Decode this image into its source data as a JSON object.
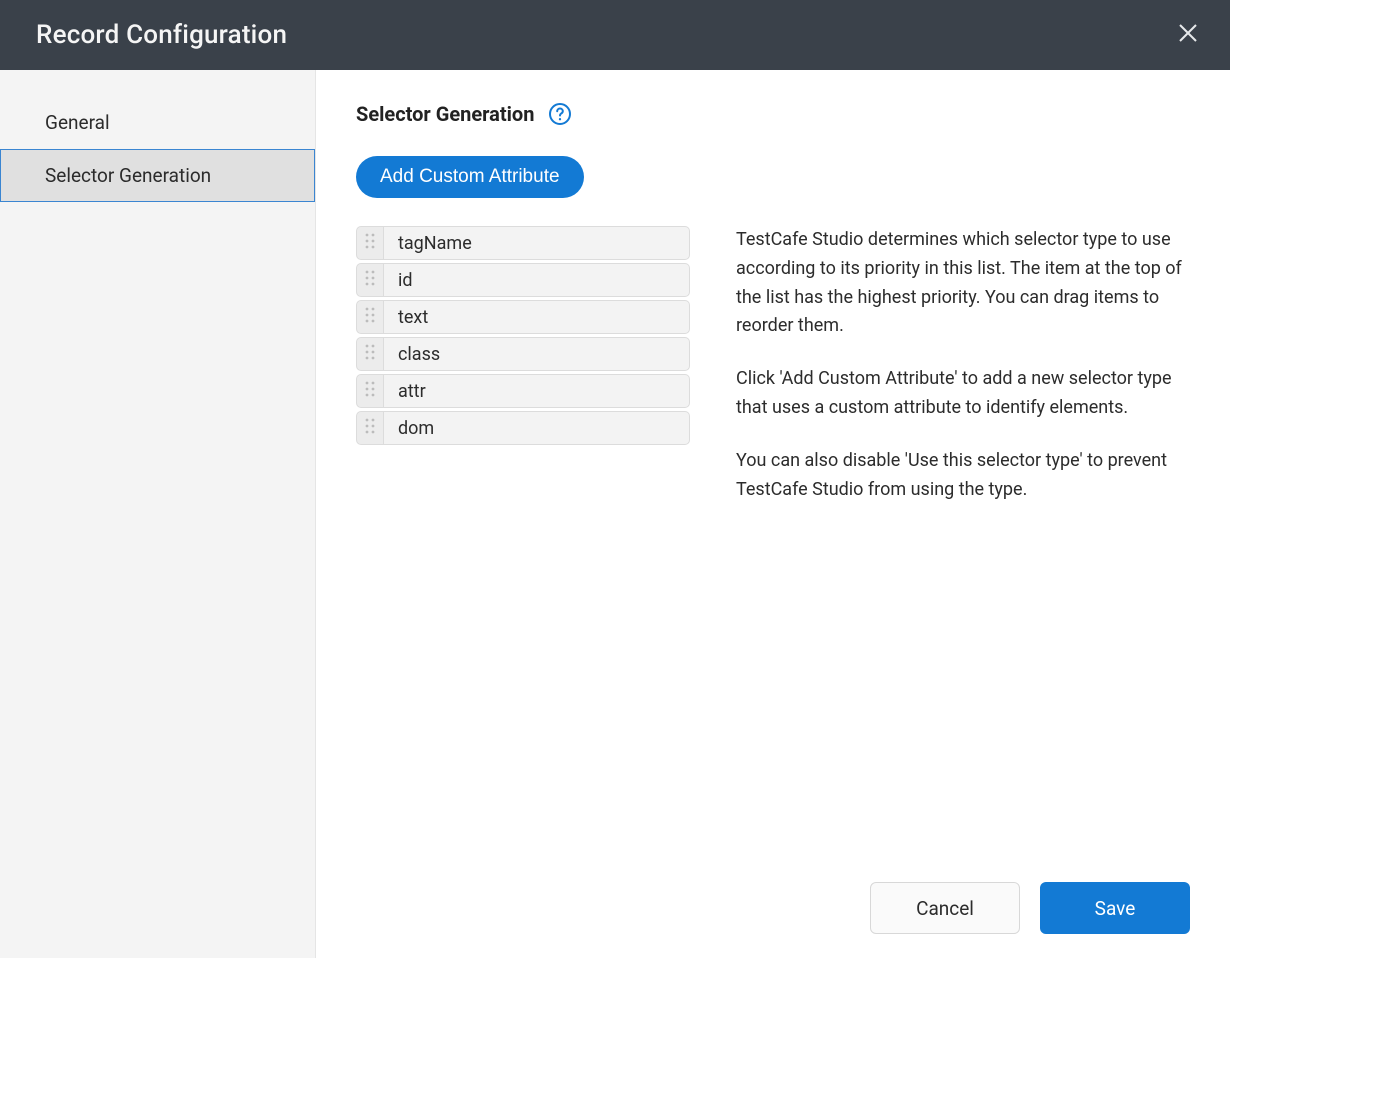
{
  "header": {
    "title": "Record Configuration"
  },
  "sidebar": {
    "items": [
      {
        "label": "General",
        "selected": false
      },
      {
        "label": "Selector Generation",
        "selected": true
      }
    ]
  },
  "main": {
    "heading": "Selector Generation",
    "addButtonLabel": "Add Custom Attribute",
    "selectors": [
      {
        "label": "tagName"
      },
      {
        "label": "id"
      },
      {
        "label": "text"
      },
      {
        "label": "class"
      },
      {
        "label": "attr"
      },
      {
        "label": "dom"
      }
    ],
    "description": [
      "TestCafe Studio determines which selector type to use according to its priority in this list. The item at the top of the list has the highest priority. You can drag items to reorder them.",
      "Click 'Add Custom Attribute' to add a new selector type that uses a custom attribute to identify elements.",
      "You can also disable 'Use this selector type' to prevent TestCafe Studio from using the type."
    ]
  },
  "footer": {
    "cancel": "Cancel",
    "save": "Save"
  }
}
